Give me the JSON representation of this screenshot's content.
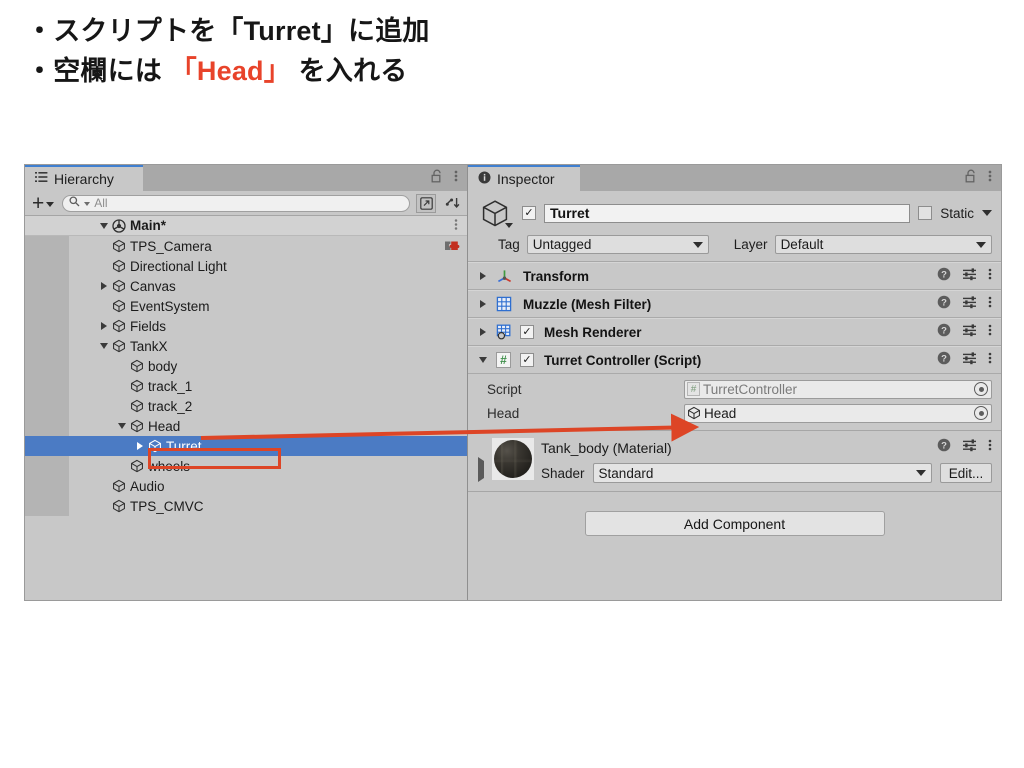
{
  "slide": {
    "line1": "・スクリプトを「Turret」に追加",
    "line2_pre": "・空欄には ",
    "line2_red": "「Head」",
    "line2_post": " を入れる",
    "accent_red": "#e8432a"
  },
  "hierarchy": {
    "tab_label": "Hierarchy",
    "tab_icon": "hierarchy-list-icon",
    "lock_icon": "lock-open-icon",
    "menu_icon": "kebab-menu-icon",
    "toolbar": {
      "add_icon": "plus-icon",
      "add_dropdown_icon": "chevron-down-icon",
      "search_icon": "search-icon",
      "search_placeholder": "All",
      "search_value": "",
      "popout_icon": "popout-window-icon",
      "sort_icon": "sort-icon"
    },
    "scene_row": {
      "label": "Main*",
      "icon": "unity-scene-icon",
      "expanded": true,
      "menu_icon": "kebab-menu-icon"
    },
    "items": [
      {
        "label": "TPS_Camera",
        "depth": 1,
        "arrow": "none",
        "icon": "gameobject-cube-icon",
        "badge": "cinemachine-icon"
      },
      {
        "label": "Directional Light",
        "depth": 1,
        "arrow": "none",
        "icon": "gameobject-cube-icon",
        "badge": ""
      },
      {
        "label": "Canvas",
        "depth": 1,
        "arrow": "collapsed",
        "icon": "gameobject-cube-icon",
        "badge": ""
      },
      {
        "label": "EventSystem",
        "depth": 1,
        "arrow": "none",
        "icon": "gameobject-cube-icon",
        "badge": ""
      },
      {
        "label": "Fields",
        "depth": 1,
        "arrow": "collapsed",
        "icon": "gameobject-cube-icon",
        "badge": ""
      },
      {
        "label": "TankX",
        "depth": 1,
        "arrow": "expanded",
        "icon": "gameobject-cube-icon",
        "badge": ""
      },
      {
        "label": "body",
        "depth": 2,
        "arrow": "none",
        "icon": "gameobject-cube-icon",
        "badge": ""
      },
      {
        "label": "track_1",
        "depth": 2,
        "arrow": "none",
        "icon": "gameobject-cube-icon",
        "badge": ""
      },
      {
        "label": "track_2",
        "depth": 2,
        "arrow": "none",
        "icon": "gameobject-cube-icon",
        "badge": ""
      },
      {
        "label": "Head",
        "depth": 2,
        "arrow": "expanded",
        "icon": "gameobject-cube-icon",
        "badge": ""
      },
      {
        "label": "Turret",
        "depth": 3,
        "arrow": "collapsed",
        "icon": "gameobject-cube-icon",
        "badge": "",
        "selected": true
      },
      {
        "label": "wheels",
        "depth": 2,
        "arrow": "none",
        "icon": "gameobject-cube-icon",
        "badge": ""
      },
      {
        "label": "Audio",
        "depth": 1,
        "arrow": "none",
        "icon": "gameobject-cube-icon",
        "badge": ""
      },
      {
        "label": "TPS_CMVC",
        "depth": 1,
        "arrow": "none",
        "icon": "gameobject-cube-icon",
        "badge": ""
      }
    ],
    "selection_color": "#4b7bc4"
  },
  "inspector": {
    "tab_label": "Inspector",
    "tab_icon": "info-circle-icon",
    "lock_icon": "lock-open-icon",
    "menu_icon": "kebab-menu-icon",
    "object_icon": "gameobject-cube-icon",
    "enabled_checkbox": true,
    "enabled_check_glyph": "✓",
    "name_value": "Turret",
    "static_label": "Static",
    "static_checked": false,
    "static_dropdown_icon": "chevron-down-icon",
    "tag_label": "Tag",
    "tag_value": "Untagged",
    "layer_label": "Layer",
    "layer_value": "Default",
    "components": [
      {
        "title": "Transform",
        "icon": "transform-axis-icon",
        "expanded": false,
        "has_toggle": false,
        "enabled": false
      },
      {
        "title": "Muzzle (Mesh Filter)",
        "icon": "mesh-filter-grid-icon",
        "expanded": false,
        "has_toggle": false,
        "enabled": false
      },
      {
        "title": "Mesh Renderer",
        "icon": "mesh-renderer-icon",
        "expanded": false,
        "has_toggle": true,
        "enabled": true
      },
      {
        "title": "Turret Controller (Script)",
        "icon": "csharp-script-icon",
        "expanded": true,
        "has_toggle": true,
        "enabled": true
      }
    ],
    "component_help_icon": "help-circle-icon",
    "component_preset_icon": "preset-sliders-icon",
    "component_menu_icon": "kebab-menu-icon",
    "properties": [
      {
        "label": "Script",
        "value": "TurretController",
        "icon": "csharp-badge-icon",
        "disabled": true,
        "picker_icon": "object-picker-icon"
      },
      {
        "label": "Head",
        "value": "Head",
        "icon": "gameobject-cube-icon",
        "disabled": false,
        "picker_icon": "object-picker-icon"
      }
    ],
    "material": {
      "title": "Tank_body (Material)",
      "preview_icon": "material-sphere-preview",
      "foldout_icon": "triangle-right-icon",
      "shader_label": "Shader",
      "shader_value": "Standard",
      "shader_dropdown_icon": "chevron-down-icon",
      "edit_label": "Edit...",
      "help_icon": "help-circle-icon",
      "preset_icon": "preset-sliders-icon",
      "menu_icon": "kebab-menu-icon"
    },
    "add_component_label": "Add Component"
  },
  "annotations": {
    "arrow_color": "#dd4526",
    "box_color": "#dd4526",
    "arrow_from_label": "Head",
    "arrow_to_label": "Head",
    "box_target": "Turret"
  }
}
